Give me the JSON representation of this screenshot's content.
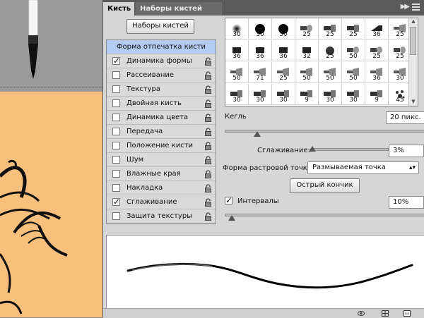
{
  "tabs": {
    "brush": "Кисть",
    "brush_presets": "Наборы кистей"
  },
  "presets_button": "Наборы кистей",
  "brush_tip_shape_header": "Форма отпечатка кисти",
  "options": [
    {
      "label": "Динамика формы",
      "checked": true
    },
    {
      "label": "Рассеивание",
      "checked": false
    },
    {
      "label": "Текстура",
      "checked": false
    },
    {
      "label": "Двойная кисть",
      "checked": false
    },
    {
      "label": "Динамика цвета",
      "checked": false
    },
    {
      "label": "Передача",
      "checked": false
    },
    {
      "label": "Положение кисти",
      "checked": false
    },
    {
      "label": "Шум",
      "checked": false
    },
    {
      "label": "Влажные края",
      "checked": false
    },
    {
      "label": "Накладка",
      "checked": false
    },
    {
      "label": "Сглаживание",
      "checked": true
    },
    {
      "label": "Защита текстуры",
      "checked": false
    }
  ],
  "tip_sizes": [
    [
      "30",
      "30",
      "30",
      "25",
      "25",
      "25",
      "36",
      "25"
    ],
    [
      "36",
      "36",
      "36",
      "32",
      "25",
      "50",
      "25",
      "25"
    ],
    [
      "50",
      "71",
      "25",
      "50",
      "50",
      "50",
      "36",
      "30"
    ],
    [
      "30",
      "30",
      "30",
      "9",
      "30",
      "30",
      "9",
      "45"
    ]
  ],
  "size": {
    "label": "Кегль",
    "value": "20 пикс."
  },
  "smoothing": {
    "label": "Сглаживание:",
    "value": "3%"
  },
  "bristle_shape": {
    "label": "Форма растровой точки:",
    "value": "Размываемая точка"
  },
  "sharp_tip_button": "Острый кончик",
  "spacing": {
    "label": "Интервалы",
    "value": "10%",
    "checked": true
  },
  "icons": {
    "menu": "panel-menu-icon",
    "lock": "lock-icon",
    "check": "✓"
  }
}
